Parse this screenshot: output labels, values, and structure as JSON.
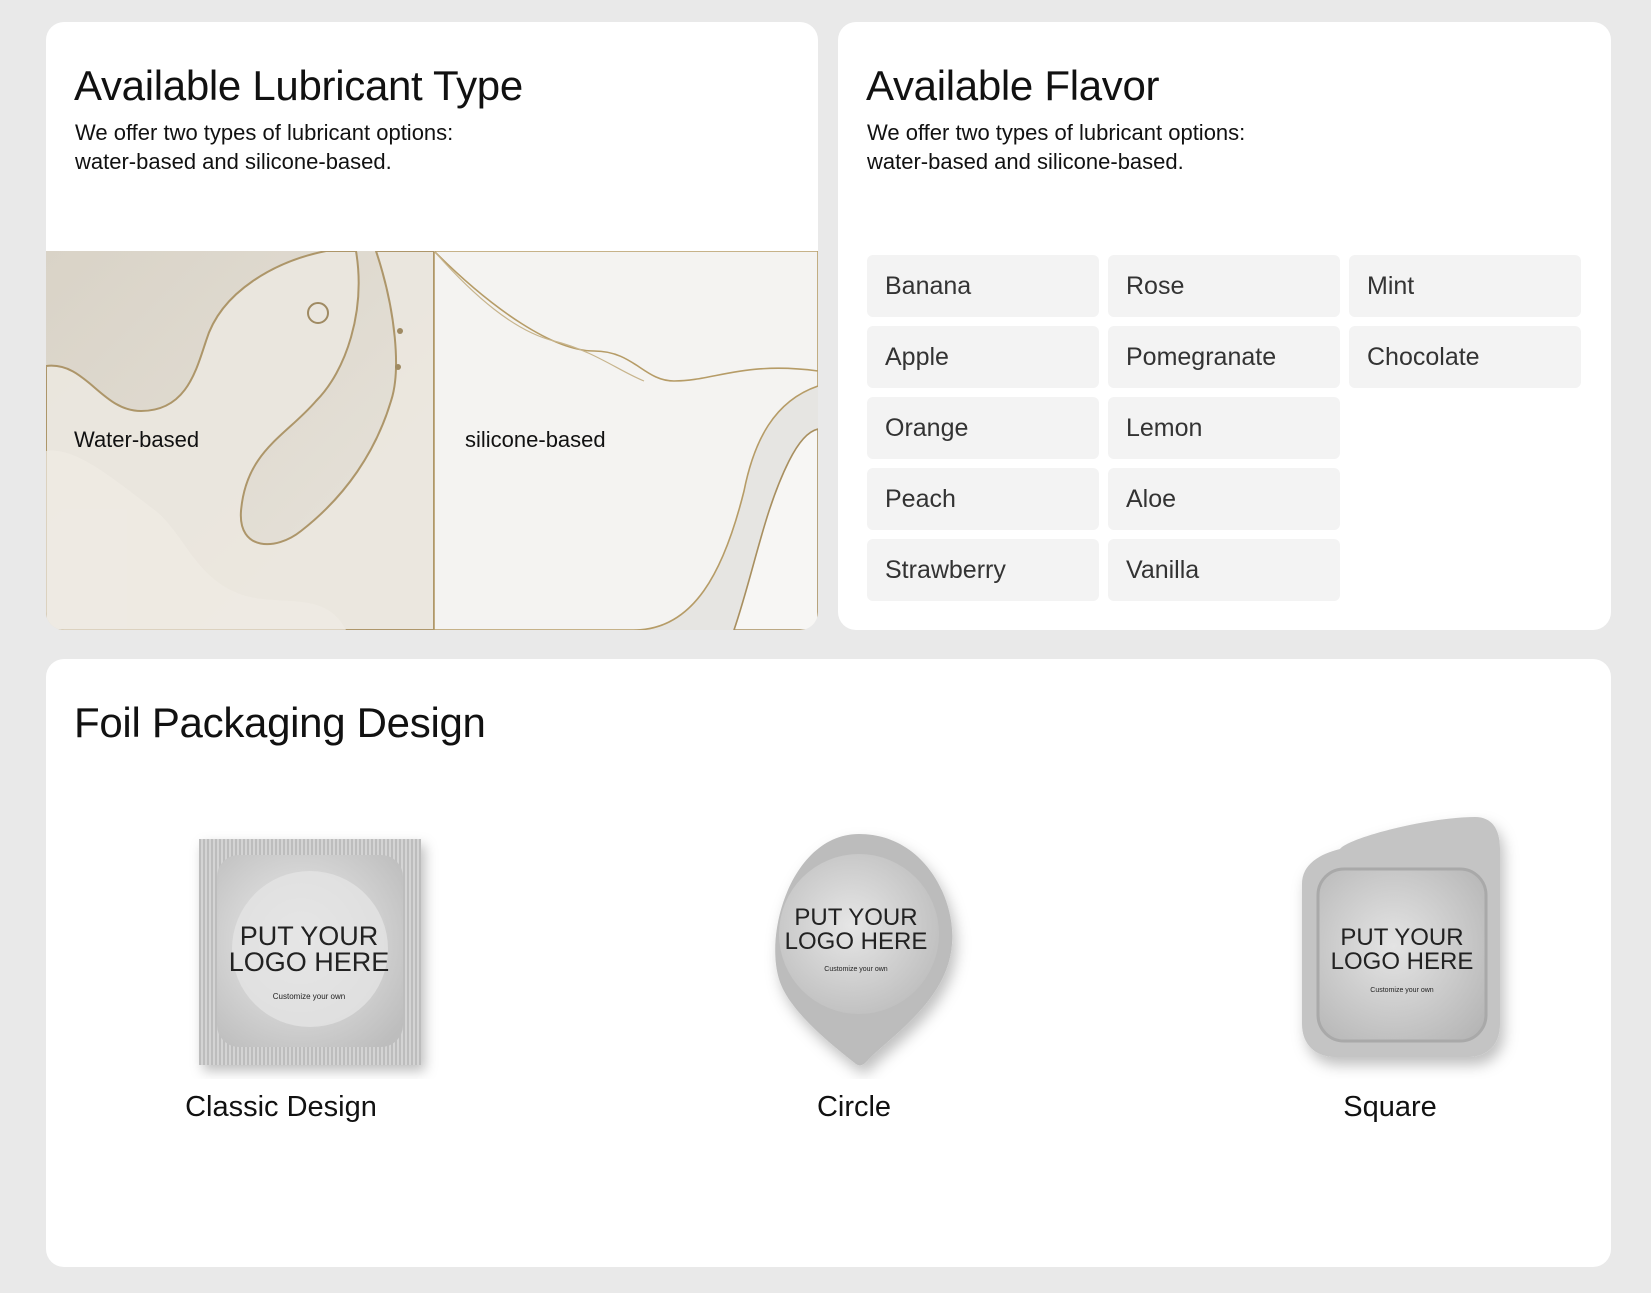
{
  "lubricant": {
    "title": "Available Lubricant Type",
    "desc_line1": "We offer two types of lubricant options:",
    "desc_line2": "water-based and silicone-based.",
    "types": [
      {
        "label": "Water-based"
      },
      {
        "label": "silicone-based"
      }
    ]
  },
  "flavor": {
    "title": "Available Flavor",
    "desc_line1": "We offer two types of lubricant options:",
    "desc_line2": "water-based and silicone-based.",
    "items": [
      "Banana",
      "Rose",
      "Mint",
      "Apple",
      "Pomegranate",
      "Chocolate",
      "Orange",
      "Lemon",
      "",
      "Peach",
      "Aloe",
      "",
      "Strawberry",
      "Vanilla",
      ""
    ]
  },
  "foil": {
    "title": "Foil Packaging Design",
    "logo_line1": "PUT YOUR",
    "logo_line2": "LOGO HERE",
    "logo_sub": "Customize your own",
    "designs": [
      {
        "label": "Classic Design"
      },
      {
        "label": "Circle"
      },
      {
        "label": "Square"
      }
    ]
  }
}
